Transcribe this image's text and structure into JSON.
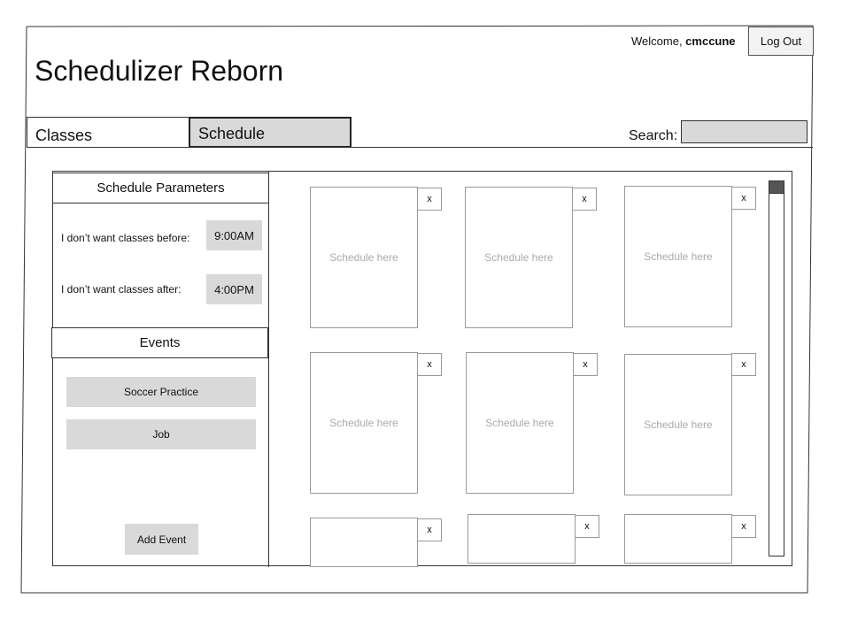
{
  "header": {
    "welcome_prefix": "Welcome, ",
    "username": "cmccune",
    "logout_label": "Log Out",
    "app_title": "Schedulizer Reborn"
  },
  "tabs": [
    {
      "label": "Classes",
      "active": false
    },
    {
      "label": "Schedule",
      "active": true
    }
  ],
  "search": {
    "label": "Search:",
    "value": ""
  },
  "sidebar": {
    "params_title": "Schedule Parameters",
    "before_label": "I don’t want classes before:",
    "before_value": "9:00AM",
    "after_label": "I don’t want classes after:",
    "after_value": "4:00PM",
    "events_title": "Events",
    "events": [
      "Soccer Practice",
      "Job"
    ],
    "add_event_label": "Add Event"
  },
  "schedules": {
    "placeholder": "Schedule here",
    "close_label": "x",
    "cards": [
      {
        "placeholder": "Schedule here"
      },
      {
        "placeholder": "Schedule here"
      },
      {
        "placeholder": "Schedule here"
      },
      {
        "placeholder": "Schedule here"
      },
      {
        "placeholder": "Schedule here"
      },
      {
        "placeholder": "Schedule here"
      },
      {
        "placeholder": ""
      },
      {
        "placeholder": ""
      },
      {
        "placeholder": ""
      }
    ]
  },
  "colors": {
    "button_fill": "#d9d9d9",
    "border": "#333333",
    "placeholder_text": "#aaaaaa",
    "scroll_thumb": "#555555"
  }
}
